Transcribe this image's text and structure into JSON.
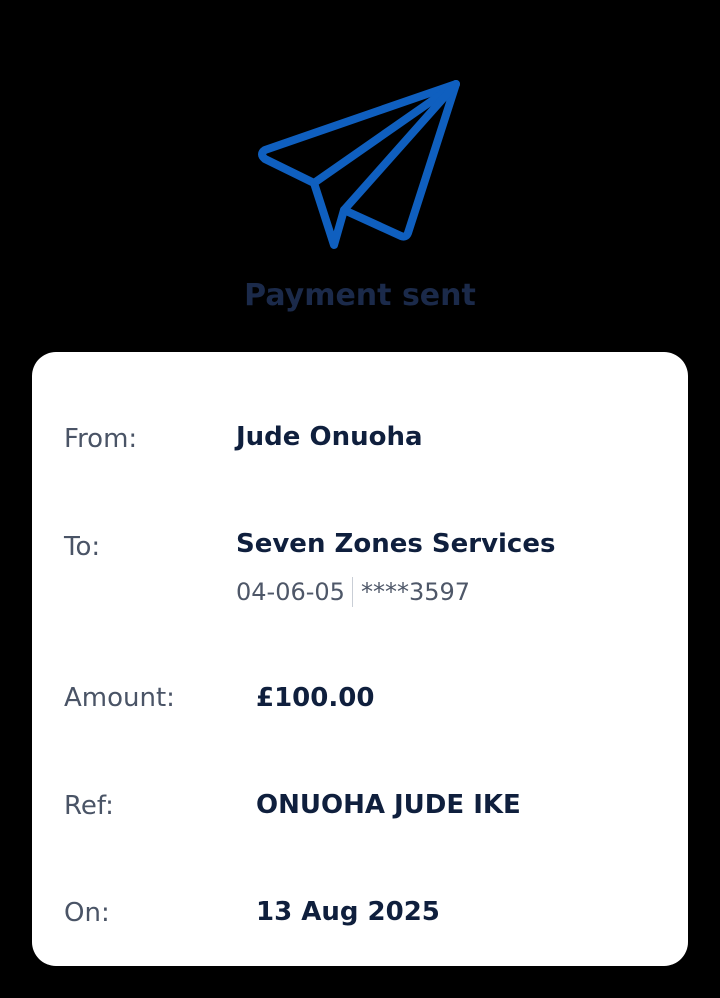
{
  "header": {
    "icon": "paper-plane-icon",
    "title": "Payment sent"
  },
  "receipt": {
    "from": {
      "label": "From:",
      "value": "Jude Onuoha"
    },
    "to": {
      "label": "To:",
      "value": "Seven Zones Services",
      "sort_code": "04-06-05",
      "account": "****3597"
    },
    "amount": {
      "label": "Amount:",
      "value": "£100.00"
    },
    "ref": {
      "label": "Ref:",
      "value": "ONUOHA JUDE IKE"
    },
    "on": {
      "label": "On:",
      "value": "13 Aug 2025"
    }
  },
  "colors": {
    "background": "#000000",
    "card": "#ffffff",
    "icon_blue": "#0f5fbf",
    "title_navy": "#1b2a4a",
    "label_gray": "#4a5466",
    "value_navy": "#0f1f3d",
    "sub_gray": "#4e5768",
    "divider": "#c9ced6"
  }
}
